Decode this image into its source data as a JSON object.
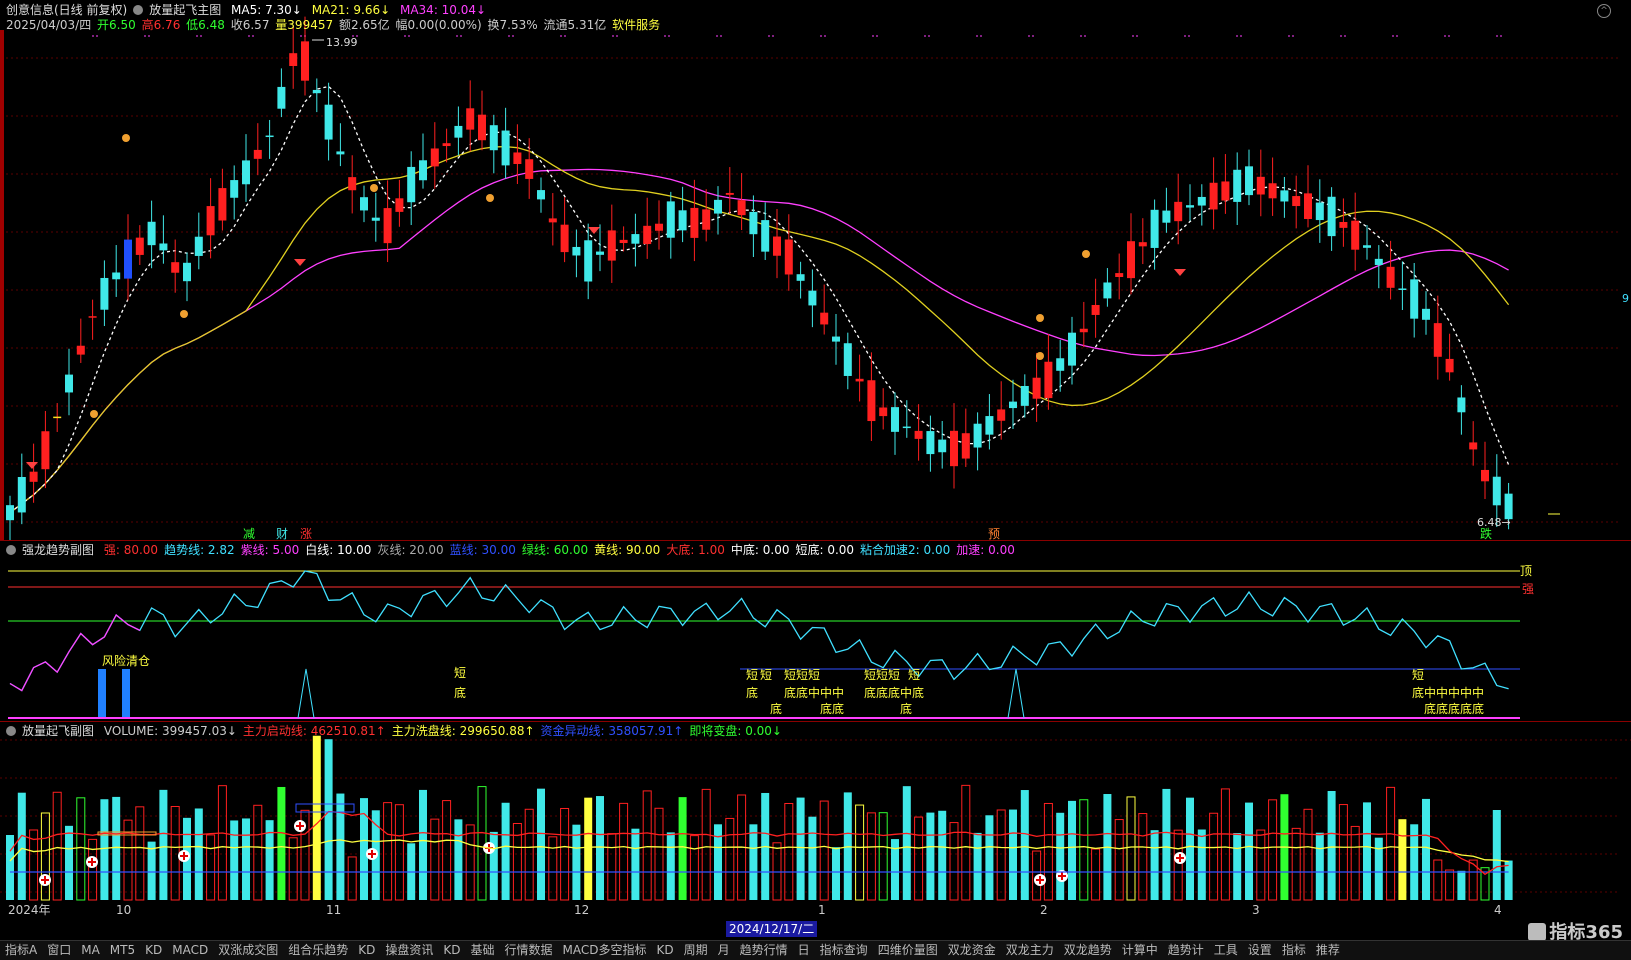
{
  "main": {
    "header_line1": {
      "stock": "创意信息(日线 前复权)",
      "indicator": "放量起飞主图",
      "ma5": "MA5: 7.30↓",
      "ma21": "MA21: 9.66↓",
      "ma34": "MA34: 10.04↓"
    },
    "header_line2": {
      "date": "2025/04/03/四",
      "open": "开6.50",
      "high": "高6.76",
      "low": "低6.48",
      "close": "收6.57",
      "vol": "量399457",
      "amount": "额2.65亿",
      "change": "幅0.00(0.00%)",
      "turnover": "换7.53%",
      "float": "流通5.31亿",
      "service": "软件服务"
    },
    "max_label": "13.99",
    "min_label": "6.48",
    "right_edge_label": "9",
    "markers": [
      "减",
      "财",
      "涨",
      "预",
      "跌"
    ]
  },
  "sub1": {
    "title": "强龙趋势副图",
    "values": [
      {
        "k": "强: 80.00",
        "c": "#ff3030"
      },
      {
        "k": "趋势线: 2.82",
        "c": "#40e0ff"
      },
      {
        "k": "紫线: 5.00",
        "c": "#ff40ff"
      },
      {
        "k": "白线: 10.00",
        "c": "#ffffff"
      },
      {
        "k": "灰线: 20.00",
        "c": "#aaaaaa"
      },
      {
        "k": "蓝线: 30.00",
        "c": "#3050ff"
      },
      {
        "k": "绿线: 60.00",
        "c": "#30ff30"
      },
      {
        "k": "黄线: 90.00",
        "c": "#ffff40"
      },
      {
        "k": "大底: 1.00",
        "c": "#ff3030"
      },
      {
        "k": "中底: 0.00",
        "c": "#ffffff"
      },
      {
        "k": "短底: 0.00",
        "c": "#ffffff"
      },
      {
        "k": "粘合加速2: 0.00",
        "c": "#40e0ff"
      },
      {
        "k": "加速: 0.00",
        "c": "#ff40ff"
      }
    ],
    "label_top": "顶",
    "label_strong": "强",
    "risk_label": "风险清仓",
    "short_label": "短",
    "bottom_label": "底",
    "mid_label": "中"
  },
  "sub2": {
    "title": "放量起飞副图",
    "values": [
      {
        "k": "VOLUME: 399457.03↓",
        "c": "#cccccc"
      },
      {
        "k": "主力启动线: 462510.81↑",
        "c": "#ff3030"
      },
      {
        "k": "主力洗盘线: 299650.88↑",
        "c": "#ffff40"
      },
      {
        "k": "资金异动线: 358057.91↑",
        "c": "#3050ff"
      },
      {
        "k": "即将变盘: 0.00↓",
        "c": "#30ff30"
      }
    ],
    "xaxis": [
      "2024年",
      "10",
      "11",
      "12",
      "1",
      "2",
      "3",
      "4"
    ],
    "cursor_date": "2024/12/17/二",
    "watermark": "指标365"
  },
  "tabs": [
    "指标A",
    "窗口",
    "MA",
    "MT5",
    "KD",
    "MACD",
    "双涨成交图",
    "组合乐趋势",
    "KD",
    "操盘资讯",
    "KD",
    "基础",
    "行情数据",
    "MACD多空指标",
    "KD",
    "周期",
    "月",
    "趋势行情",
    "日",
    "指标查询",
    "四维价量图",
    "双龙资金",
    "双龙主力",
    "双龙趋势",
    "计算中",
    "趋势计",
    "工具",
    "设置",
    "指标",
    "推荐"
  ]
}
